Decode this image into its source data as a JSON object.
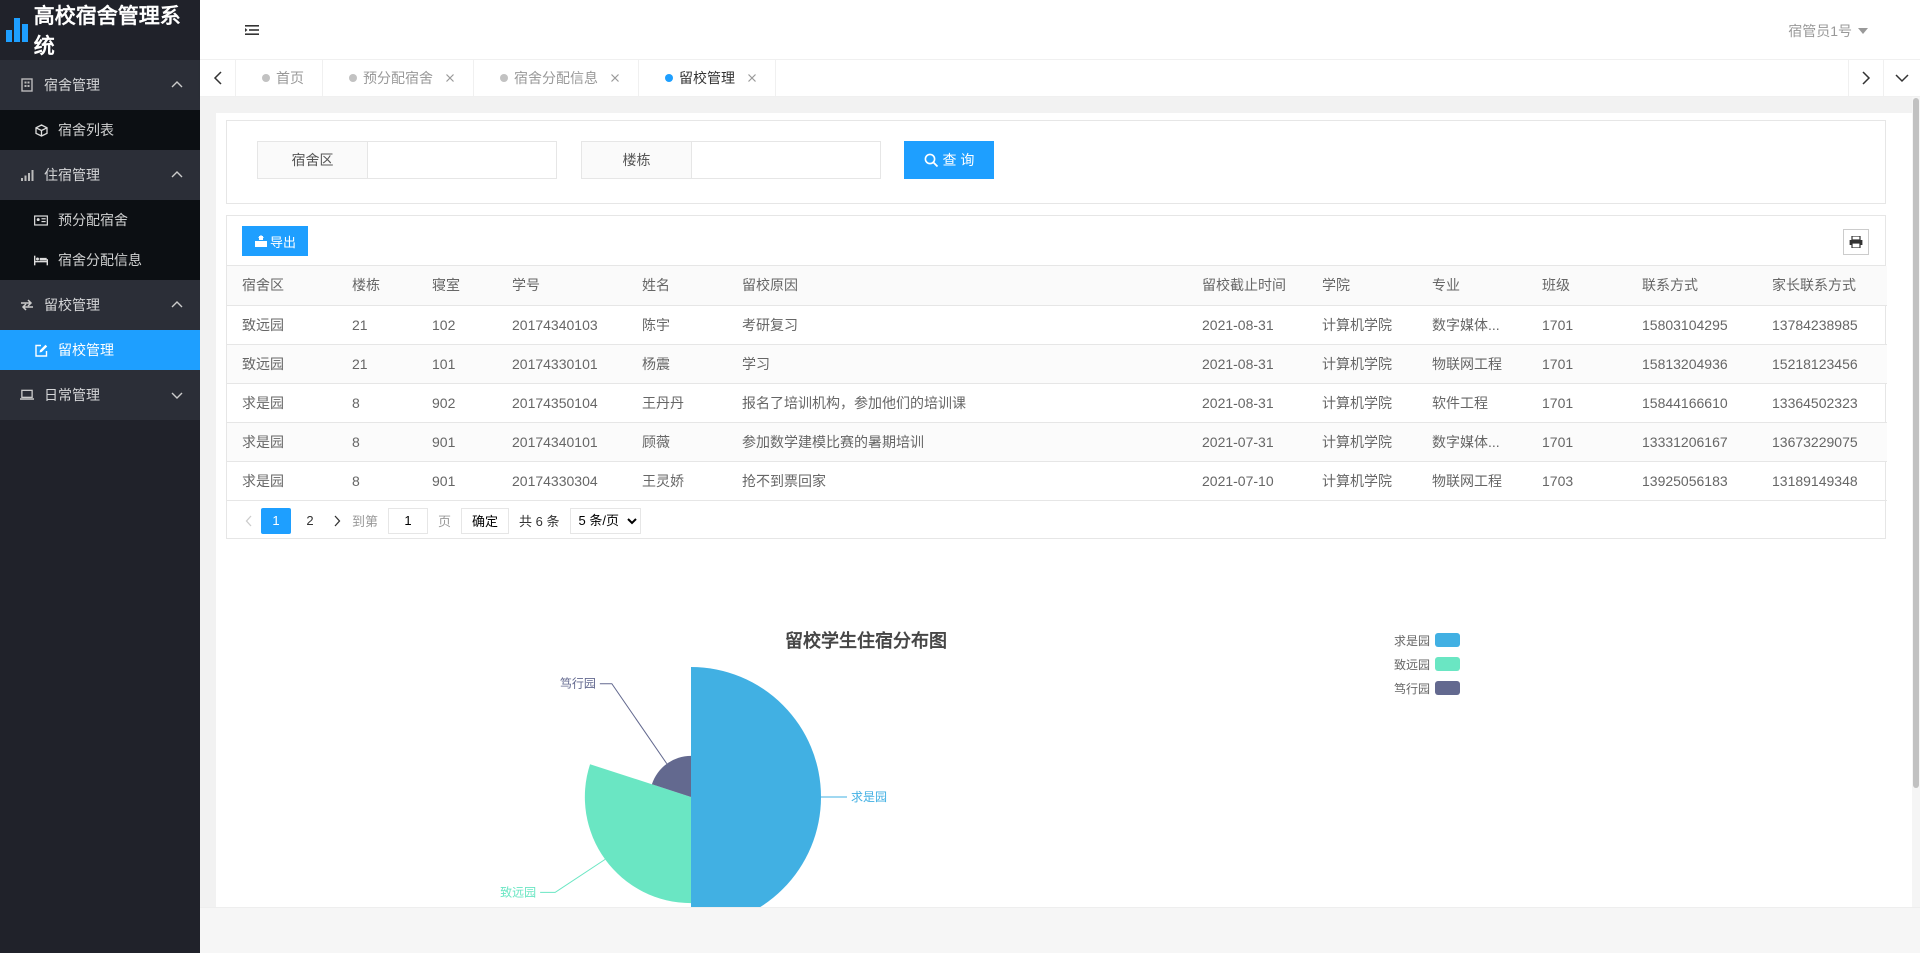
{
  "app": {
    "title": "高校宿舍管理系统"
  },
  "header": {
    "user_name": "宿管员1号"
  },
  "sidebar": {
    "groups": [
      {
        "label": "宿舍管理",
        "icon": "building-icon",
        "expanded": true,
        "children": [
          {
            "label": "宿舍列表",
            "icon": "cube-icon",
            "active": false
          }
        ]
      },
      {
        "label": "住宿管理",
        "icon": "signal-icon",
        "expanded": true,
        "children": [
          {
            "label": "预分配宿舍",
            "icon": "id-card-icon",
            "active": false
          },
          {
            "label": "宿舍分配信息",
            "icon": "bed-icon",
            "active": false
          }
        ]
      },
      {
        "label": "留校管理",
        "icon": "exchange-icon",
        "expanded": true,
        "children": [
          {
            "label": "留校管理",
            "icon": "edit-icon",
            "active": true
          }
        ]
      },
      {
        "label": "日常管理",
        "icon": "laptop-icon",
        "expanded": false,
        "children": []
      }
    ]
  },
  "tabs": [
    {
      "label": "首页",
      "closable": false,
      "active": false
    },
    {
      "label": "预分配宿舍",
      "closable": true,
      "active": false
    },
    {
      "label": "宿舍分配信息",
      "closable": true,
      "active": false
    },
    {
      "label": "留校管理",
      "closable": true,
      "active": true
    }
  ],
  "search": {
    "area_label": "宿舍区",
    "area_value": "",
    "building_label": "楼栋",
    "building_value": "",
    "query_label": "查 询"
  },
  "toolbar": {
    "export_label": "导出"
  },
  "table": {
    "columns": [
      "宿舍区",
      "楼栋",
      "寝室",
      "学号",
      "姓名",
      "留校原因",
      "留校截止时间",
      "学院",
      "专业",
      "班级",
      "联系方式",
      "家长联系方式"
    ],
    "rows": [
      [
        "致远园",
        "21",
        "102",
        "20174340103",
        "陈宇",
        "考研复习",
        "2021-08-31",
        "计算机学院",
        "数字媒体...",
        "1701",
        "15803104295",
        "13784238985"
      ],
      [
        "致远园",
        "21",
        "101",
        "20174330101",
        "杨震",
        "学习",
        "2021-08-31",
        "计算机学院",
        "物联网工程",
        "1701",
        "15813204936",
        "15218123456"
      ],
      [
        "求是园",
        "8",
        "902",
        "20174350104",
        "王丹丹",
        "报名了培训机构，参加他们的培训课",
        "2021-08-31",
        "计算机学院",
        "软件工程",
        "1701",
        "15844166610",
        "13364502323"
      ],
      [
        "求是园",
        "8",
        "901",
        "20174340101",
        "顾薇",
        "参加数学建模比赛的暑期培训",
        "2021-07-31",
        "计算机学院",
        "数字媒体...",
        "1701",
        "13331206167",
        "13673229075"
      ],
      [
        "求是园",
        "8",
        "901",
        "20174330304",
        "王灵娇",
        "抢不到票回家",
        "2021-07-10",
        "计算机学院",
        "物联网工程",
        "1703",
        "13925056183",
        "13189149348"
      ]
    ]
  },
  "pager": {
    "pages": [
      "1",
      "2"
    ],
    "current": "1",
    "goto_prefix": "到第",
    "goto_value": "1",
    "goto_suffix": "页",
    "confirm_label": "确定",
    "total_text": "共 6 条",
    "page_size": "5 条/页"
  },
  "chart_data": {
    "type": "pie",
    "title": "留校学生住宿分布图",
    "labels": [
      "求是园",
      "致远园",
      "笃行园"
    ],
    "values": [
      3,
      2,
      0.3
    ],
    "colors": [
      "#41b0e3",
      "#6ae6c3",
      "#63698f"
    ],
    "legend": "top-right"
  }
}
